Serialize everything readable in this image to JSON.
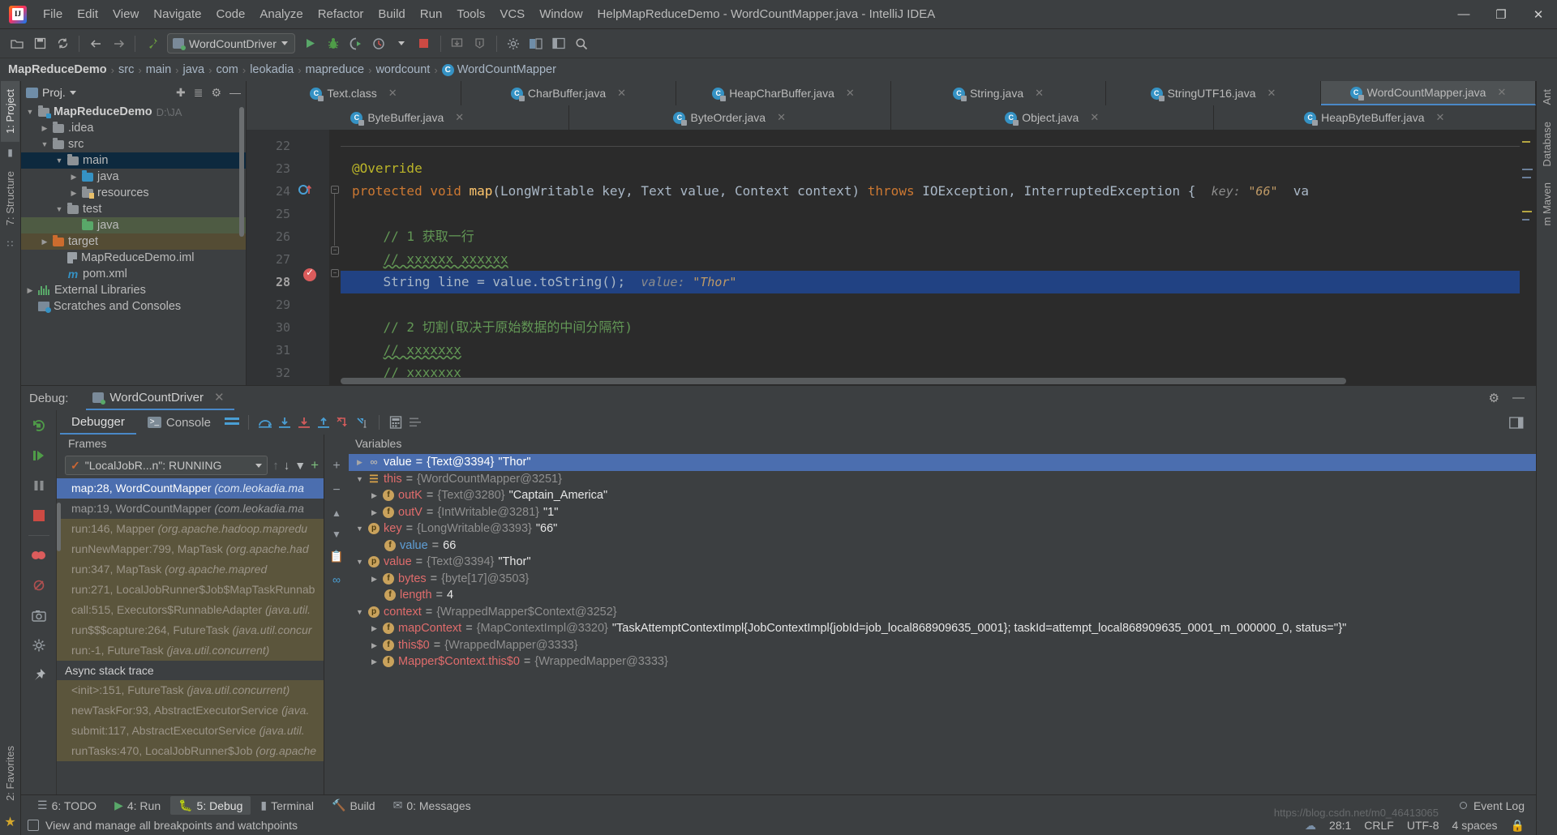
{
  "window": {
    "title": "MapReduceDemo - WordCountMapper.java - IntelliJ IDEA",
    "minimize": "—",
    "maximize": "❐",
    "close": "✕"
  },
  "menubar": [
    {
      "label": "File"
    },
    {
      "label": "Edit"
    },
    {
      "label": "View"
    },
    {
      "label": "Navigate"
    },
    {
      "label": "Code"
    },
    {
      "label": "Analyze"
    },
    {
      "label": "Refactor"
    },
    {
      "label": "Build"
    },
    {
      "label": "Run"
    },
    {
      "label": "Tools"
    },
    {
      "label": "VCS"
    },
    {
      "label": "Window"
    },
    {
      "label": "Help"
    }
  ],
  "toolbar": {
    "run_config": "WordCountDriver",
    "icons": [
      "open-folder-icon",
      "save-all-icon",
      "sync-icon",
      "back-arrow-icon",
      "forward-arrow-icon",
      "build-hammer-icon",
      "run-icon",
      "debug-icon",
      "run-coverage-icon",
      "profiler-icon",
      "stop-icon",
      "update-project-icon",
      "commit-icon",
      "settings-icon",
      "project-structure-icon",
      "layout-icon",
      "search-everywhere-icon"
    ]
  },
  "breadcrumb": {
    "items": [
      "MapReduceDemo",
      "src",
      "main",
      "java",
      "com",
      "leokadia",
      "mapreduce",
      "wordcount"
    ],
    "last": "WordCountMapper",
    "last_icon": "class-icon",
    "separator": "›"
  },
  "left_rail": {
    "project_tab": "1: Project",
    "structure_tab": "7: Structure",
    "favorites_tab": "2: Favorites"
  },
  "right_rail": {
    "ant_tab": "Ant",
    "database_tab": "Database",
    "maven_tab": "m  Maven"
  },
  "project": {
    "header_label": "Proj.",
    "header_icons": [
      "locate-icon",
      "collapse-all-icon",
      "settings-icon",
      "hide-icon"
    ],
    "tree": [
      {
        "indent": 0,
        "arrow": "▼",
        "icon": "folder-src",
        "label": "MapReduceDemo",
        "bold": true,
        "path": "D:\\JA",
        "state": "normal"
      },
      {
        "indent": 1,
        "arrow": "▶",
        "icon": "folder",
        "label": ".idea",
        "bold": false,
        "path": "",
        "state": "normal"
      },
      {
        "indent": 1,
        "arrow": "▼",
        "icon": "folder",
        "label": "src",
        "bold": false,
        "path": "",
        "state": "normal"
      },
      {
        "indent": 2,
        "arrow": "▼",
        "icon": "folder",
        "label": "main",
        "bold": false,
        "path": "",
        "state": "sel-blue"
      },
      {
        "indent": 3,
        "arrow": "▶",
        "icon": "folder-blue",
        "label": "java",
        "bold": false,
        "path": "",
        "state": "normal"
      },
      {
        "indent": 3,
        "arrow": "▶",
        "icon": "folder-res",
        "label": "resources",
        "bold": false,
        "path": "",
        "state": "normal"
      },
      {
        "indent": 2,
        "arrow": "▼",
        "icon": "folder",
        "label": "test",
        "bold": false,
        "path": "",
        "state": "normal"
      },
      {
        "indent": 3,
        "arrow": "",
        "icon": "folder-green",
        "label": "java",
        "bold": false,
        "path": "",
        "state": "sel-green"
      },
      {
        "indent": 1,
        "arrow": "▶",
        "icon": "folder-orange",
        "label": "target",
        "bold": false,
        "path": "",
        "state": "sel-brown"
      },
      {
        "indent": 2,
        "arrow": "",
        "icon": "iml",
        "label": "MapReduceDemo.iml",
        "bold": false,
        "path": "",
        "state": "normal"
      },
      {
        "indent": 2,
        "arrow": "",
        "icon": "maven-m",
        "label": "pom.xml",
        "bold": false,
        "path": "",
        "state": "normal"
      },
      {
        "indent": 0,
        "arrow": "▶",
        "icon": "library",
        "label": "External Libraries",
        "bold": false,
        "path": "",
        "state": "normal"
      },
      {
        "indent": 0,
        "arrow": "",
        "icon": "scratch",
        "label": "Scratches and Consoles",
        "bold": false,
        "path": "",
        "state": "normal"
      }
    ]
  },
  "editor": {
    "tabs_row1": [
      {
        "label": "Text.class",
        "active": false
      },
      {
        "label": "CharBuffer.java",
        "active": false
      },
      {
        "label": "HeapCharBuffer.java",
        "active": false
      },
      {
        "label": "String.java",
        "active": false
      },
      {
        "label": "StringUTF16.java",
        "active": false
      },
      {
        "label": "WordCountMapper.java",
        "active": true
      }
    ],
    "tabs_row2": [
      {
        "label": "ByteBuffer.java",
        "active": false
      },
      {
        "label": "ByteOrder.java",
        "active": false
      },
      {
        "label": "Object.java",
        "active": false
      },
      {
        "label": "HeapByteBuffer.java",
        "active": false
      }
    ],
    "close_glyph": "✕",
    "lines": [
      {
        "num": "22",
        "segments": [],
        "current": false
      },
      {
        "num": "23",
        "segments": [
          {
            "t": "@Override",
            "c": "k-anno",
            "pad": 4
          }
        ],
        "current": false
      },
      {
        "num": "24",
        "segments": [
          {
            "t": "protected void ",
            "c": "k-kw",
            "pad": 4
          },
          {
            "t": "map",
            "c": "k-meth"
          },
          {
            "t": "(LongWritable key, Text value, Context context) ",
            "c": "k-type"
          },
          {
            "t": "throws ",
            "c": "k-kw"
          },
          {
            "t": "IOException, InterruptedException {",
            "c": "k-type"
          }
        ],
        "current": false,
        "inlay_label": "key:",
        "inlay_value": "\"66\"",
        "tail": "va"
      },
      {
        "num": "25",
        "segments": [],
        "current": false
      },
      {
        "num": "26",
        "segments": [
          {
            "t": "// 1 获取一行",
            "c": "k-com",
            "pad": 8
          }
        ],
        "current": false
      },
      {
        "num": "27",
        "segments": [
          {
            "t": "// xxxxxx xxxxxx",
            "c": "k-com squiggle",
            "pad": 8
          }
        ],
        "current": false
      },
      {
        "num": "28",
        "segments": [
          {
            "t": "String line = value.toString();",
            "c": "k-plain",
            "pad": 8
          }
        ],
        "current": true,
        "inlay_label": "value:",
        "inlay_value": "\"Thor\""
      },
      {
        "num": "29",
        "segments": [],
        "current": false
      },
      {
        "num": "30",
        "segments": [
          {
            "t": "// 2 切割(取决于原始数据的中间分隔符)",
            "c": "k-com",
            "pad": 8
          }
        ],
        "current": false
      },
      {
        "num": "31",
        "segments": [
          {
            "t": "// xxxxxxx",
            "c": "k-com squiggle",
            "pad": 8
          }
        ],
        "current": false
      },
      {
        "num": "32",
        "segments": [
          {
            "t": "// xxxxxxx",
            "c": "k-com squiggle",
            "pad": 8
          }
        ],
        "current": false
      }
    ]
  },
  "debug": {
    "label": "Debug:",
    "session_tab": "WordCountDriver",
    "close_glyph": "✕",
    "settings_icon": "gear-icon",
    "hide_icon": "hide-icon",
    "tabs": [
      {
        "label": "Debugger",
        "active": true,
        "icon": ""
      },
      {
        "label": "Console",
        "active": false,
        "icon": "console-icon"
      }
    ],
    "tools": [
      "layout-icon",
      "step-over-icon",
      "step-into-icon",
      "force-step-into-icon",
      "step-out-icon",
      "drop-frame-icon",
      "run-to-cursor-icon",
      "evaluate-icon",
      "watches-icon"
    ],
    "rail_buttons": [
      "rerun-icon",
      "resume-icon",
      "pause-icon",
      "stop-icon",
      "mute-breakpoints-icon",
      "view-breakpoints-icon",
      "disable-breakpoints-icon",
      "camera-icon",
      "settings-icon",
      "pin-icon"
    ],
    "frames": {
      "title": "Frames",
      "thread": "\"LocalJobR...n\": RUNNING",
      "buttons": [
        "up-arrow-icon",
        "down-arrow-icon",
        "filter-icon"
      ],
      "items": [
        {
          "method": "map:28, WordCountMapper ",
          "pkg": "(com.leokadia.ma",
          "state": "sel"
        },
        {
          "method": "map:19, WordCountMapper ",
          "pkg": "(com.leokadia.ma",
          "state": "normal"
        },
        {
          "method": "run:146, Mapper ",
          "pkg": "(org.apache.hadoop.mapredu",
          "state": "lib"
        },
        {
          "method": "runNewMapper:799, MapTask ",
          "pkg": "(org.apache.had",
          "state": "lib"
        },
        {
          "method": "run:347, MapTask ",
          "pkg": "(org.apache.mapred",
          "state": "lib"
        },
        {
          "method": "run:271, LocalJobRunner$Job$MapTaskRunnab",
          "pkg": "",
          "state": "lib"
        },
        {
          "method": "call:515, Executors$RunnableAdapter ",
          "pkg": "(java.util.",
          "state": "lib"
        },
        {
          "method": "run$$$capture:264, FutureTask ",
          "pkg": "(java.util.concur",
          "state": "lib"
        },
        {
          "method": "run:-1, FutureTask ",
          "pkg": "(java.util.concurrent)",
          "state": "lib"
        }
      ],
      "async_title": "Async stack trace",
      "async_items": [
        {
          "method": "<init>:151, FutureTask ",
          "pkg": "(java.util.concurrent)"
        },
        {
          "method": "newTaskFor:93, AbstractExecutorService ",
          "pkg": "(java."
        },
        {
          "method": "submit:117, AbstractExecutorService ",
          "pkg": "(java.util."
        },
        {
          "method": "runTasks:470, LocalJobRunner$Job ",
          "pkg": "(org.apache"
        }
      ]
    },
    "variables": {
      "title": "Variables",
      "side_buttons": [
        "add-icon",
        "remove-icon",
        "up-icon",
        "down-icon",
        "copy-icon",
        "link-icon"
      ],
      "items": [
        {
          "indent": 0,
          "arrow": "▶",
          "icon": "oo",
          "icon_kind": "none",
          "name": "value",
          "name_class": "plain",
          "eq": " = ",
          "type": "{Text@3394}",
          "value": " \"Thor\"",
          "sel": true
        },
        {
          "indent": 0,
          "arrow": "▼",
          "icon": "☰",
          "icon_kind": "stack",
          "name": "this",
          "name_class": "",
          "eq": " = ",
          "type": "{WordCountMapper@3251}",
          "value": "",
          "sel": false
        },
        {
          "indent": 1,
          "arrow": "▶",
          "icon": "f",
          "icon_kind": "f",
          "name": "outK",
          "name_class": "",
          "eq": " = ",
          "type": "{Text@3280}",
          "value": " \"Captain_America\"",
          "sel": false
        },
        {
          "indent": 1,
          "arrow": "▶",
          "icon": "f",
          "icon_kind": "f",
          "name": "outV",
          "name_class": "",
          "eq": " = ",
          "type": "{IntWritable@3281}",
          "value": " \"1\"",
          "sel": false
        },
        {
          "indent": 0,
          "arrow": "▼",
          "icon": "p",
          "icon_kind": "p",
          "name": "key",
          "name_class": "",
          "eq": " = ",
          "type": "{LongWritable@3393}",
          "value": " \"66\"",
          "sel": false
        },
        {
          "indent": 1,
          "arrow": "",
          "icon": "f",
          "icon_kind": "f",
          "name": "value",
          "name_class": "blue",
          "eq": " = ",
          "type": "",
          "value": "66",
          "sel": false
        },
        {
          "indent": 0,
          "arrow": "▼",
          "icon": "p",
          "icon_kind": "p",
          "name": "value",
          "name_class": "",
          "eq": " = ",
          "type": "{Text@3394}",
          "value": " \"Thor\"",
          "sel": false
        },
        {
          "indent": 1,
          "arrow": "▶",
          "icon": "f",
          "icon_kind": "f",
          "name": "bytes",
          "name_class": "",
          "eq": " = ",
          "type": "{byte[17]@3503}",
          "value": "",
          "sel": false
        },
        {
          "indent": 1,
          "arrow": "",
          "icon": "f",
          "icon_kind": "f",
          "name": "length",
          "name_class": "",
          "eq": " = ",
          "type": "",
          "value": "4",
          "sel": false
        },
        {
          "indent": 0,
          "arrow": "▼",
          "icon": "p",
          "icon_kind": "p",
          "name": "context",
          "name_class": "",
          "eq": " = ",
          "type": "{WrappedMapper$Context@3252}",
          "value": "",
          "sel": false
        },
        {
          "indent": 1,
          "arrow": "▶",
          "icon": "f",
          "icon_kind": "f",
          "name": "mapContext",
          "name_class": "",
          "eq": " = ",
          "type": "{MapContextImpl@3320}",
          "value": " \"TaskAttemptContextImpl{JobContextImpl{jobId=job_local868909635_0001}; taskId=attempt_local868909635_0001_m_000000_0, status=''}\"",
          "sel": false
        },
        {
          "indent": 1,
          "arrow": "▶",
          "icon": "f",
          "icon_kind": "f",
          "name": "this$0",
          "name_class": "",
          "eq": " = ",
          "type": "{WrappedMapper@3333}",
          "value": "",
          "sel": false
        },
        {
          "indent": 1,
          "arrow": "▶",
          "icon": "f",
          "icon_kind": "f",
          "name": "Mapper$Context.this$0",
          "name_class": "",
          "eq": " = ",
          "type": "{WrappedMapper@3333}",
          "value": "",
          "sel": false
        }
      ]
    }
  },
  "toolwindows": [
    {
      "label": "6: TODO",
      "icon": "todo-icon",
      "active": false
    },
    {
      "label": "4: Run",
      "icon": "run-icon",
      "active": false
    },
    {
      "label": "5: Debug",
      "icon": "debug-icon",
      "active": true
    },
    {
      "label": "Terminal",
      "icon": "terminal-icon",
      "active": false
    },
    {
      "label": "Build",
      "icon": "build-icon",
      "active": false
    },
    {
      "label": "0: Messages",
      "icon": "messages-icon",
      "active": false
    }
  ],
  "statusbar": {
    "message": "View and manage all breakpoints and watchpoints",
    "event_log": "Event Log",
    "caret": "28:1",
    "line_sep": "CRLF",
    "encoding": "UTF-8",
    "indent": "4 spaces",
    "watermark": "https://blog.csdn.net/m0_46413065"
  }
}
